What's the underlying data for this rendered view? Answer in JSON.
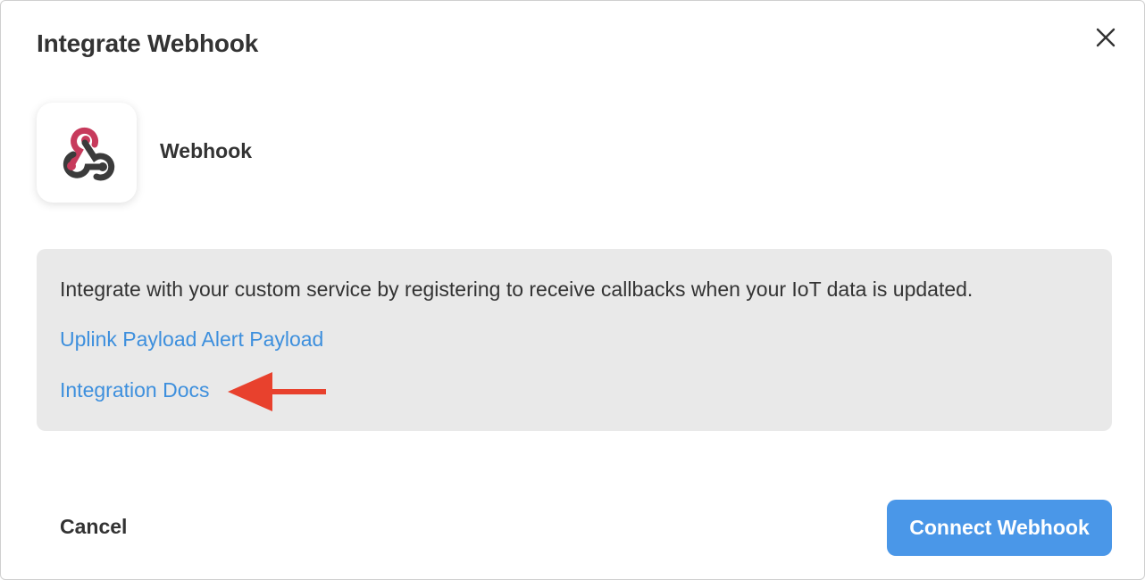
{
  "dialog": {
    "title": "Integrate Webhook",
    "close_icon": "close-icon"
  },
  "integration": {
    "logo_icon": "webhook-logo-icon",
    "name": "Webhook"
  },
  "info": {
    "description": "Integrate with your custom service by registering to receive callbacks when your IoT data is updated.",
    "links": {
      "uplink_payload": "Uplink Payload",
      "alert_payload": "Alert Payload",
      "integration_docs": "Integration Docs"
    }
  },
  "annotation": {
    "arrow_icon": "red-arrow-icon",
    "arrow_color": "#e8412d"
  },
  "footer": {
    "cancel_label": "Cancel",
    "connect_label": "Connect Webhook"
  },
  "colors": {
    "link": "#3d8fdd",
    "primary_button": "#4a97e8",
    "panel_bg": "#e9e9e9",
    "webhook_red": "#c73a5c",
    "webhook_dark": "#3b3b3b"
  }
}
